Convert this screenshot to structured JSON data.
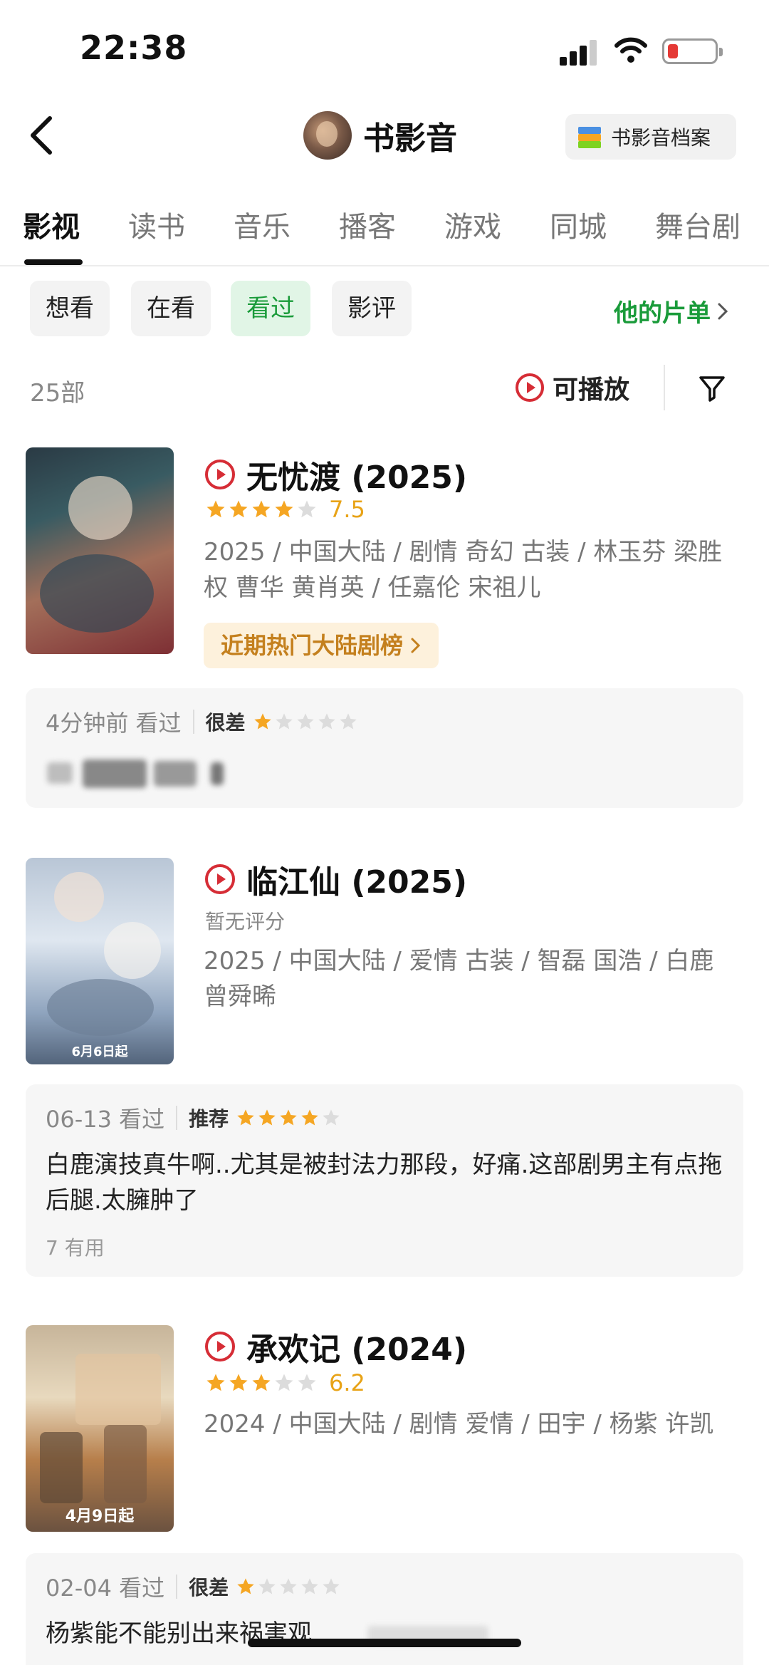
{
  "status_bar": {
    "time": "22:38"
  },
  "nav": {
    "title": "书影音",
    "archive_label": "书影音档案"
  },
  "tabs": [
    {
      "label": "影视",
      "active": true
    },
    {
      "label": "读书"
    },
    {
      "label": "音乐"
    },
    {
      "label": "播客"
    },
    {
      "label": "游戏"
    },
    {
      "label": "同城"
    },
    {
      "label": "舞台剧"
    }
  ],
  "filters": {
    "chips": [
      {
        "label": "想看"
      },
      {
        "label": "在看"
      },
      {
        "label": "看过",
        "active": true
      },
      {
        "label": "影评"
      }
    ],
    "playlist_link": "他的片单"
  },
  "list_header": {
    "count": "25部",
    "playable": "可播放"
  },
  "colors": {
    "accent_green": "#1a9b3a",
    "star_gold": "#f5a623",
    "play_red": "#d62d36"
  },
  "entries": [
    {
      "title": "无忧渡 (2025)",
      "rating_stars": 4,
      "score": "7.5",
      "meta": "2025 / 中国大陆 / 剧情 奇幻 古装 / 林玉芬 梁胜权 曹华 黄肖英 / 任嘉伦 宋祖儿",
      "hot_tag": "近期热门大陆剧榜",
      "review": {
        "time": "4分钟前 看过",
        "label": "很差",
        "stars": 1,
        "text": "",
        "useful": ""
      }
    },
    {
      "title": "临江仙 (2025)",
      "no_score": "暂无评分",
      "meta": "2025 / 中国大陆 / 爱情 古装 / 智磊 国浩 / 白鹿 曾舜晞",
      "poster_caption": "6月6日起",
      "review": {
        "time": "06-13 看过",
        "label": "推荐",
        "stars": 4,
        "text": "白鹿演技真牛啊..尤其是被封法力那段，好痛.这部剧男主有点拖后腿.太臃肿了",
        "useful": "7 有用"
      }
    },
    {
      "title": "承欢记 (2024)",
      "rating_stars": 3,
      "score": "6.2",
      "meta": "2024 / 中国大陆 / 剧情 爱情 / 田宇 / 杨紫 许凯",
      "poster_caption": "4月9日起",
      "review": {
        "time": "02-04 看过",
        "label": "很差",
        "stars": 1,
        "text": "杨紫能不能别出来祸害观",
        "useful": ""
      }
    }
  ]
}
